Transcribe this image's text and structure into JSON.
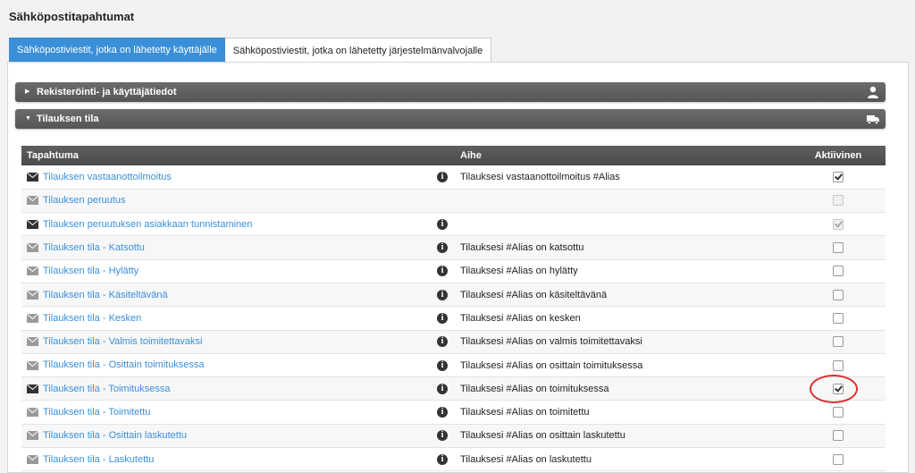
{
  "page": {
    "title": "Sähköpostitapahtumat"
  },
  "tabs": [
    {
      "label": "Sähköpostiviestit, jotka on lähetetty käyttäjälle",
      "active": true
    },
    {
      "label": "Sähköpostiviestit, jotka on lähetetty järjestelmänvalvojalle",
      "active": false
    }
  ],
  "sections": [
    {
      "label": "Rekisteröinti- ja käyttäjätiedot",
      "expanded": false,
      "icon": "user-icon"
    },
    {
      "label": "Tilauksen tila",
      "expanded": true,
      "icon": "truck-icon"
    }
  ],
  "table": {
    "headers": {
      "event": "Tapahtuma",
      "subject": "Aihe",
      "active": "Aktiivinen"
    },
    "rows": [
      {
        "event": "Tilauksen vastaanottoilmoitus",
        "subject": "Tilauksesi vastaanottoilmoitus #Alias",
        "info": true,
        "checked": true,
        "disabled": false,
        "envelope": "dark"
      },
      {
        "event": "Tilauksen peruutus",
        "subject": "",
        "info": false,
        "checked": false,
        "disabled": true,
        "envelope": "light"
      },
      {
        "event": "Tilauksen peruutuksen asiakkaan tunnistaminen",
        "subject": "",
        "info": true,
        "checked": true,
        "disabled": true,
        "envelope": "dark"
      },
      {
        "event": "Tilauksen tila - Katsottu",
        "subject": "Tilauksesi #Alias on katsottu",
        "info": true,
        "checked": false,
        "disabled": false,
        "envelope": "light"
      },
      {
        "event": "Tilauksen tila - Hylätty",
        "subject": "Tilauksesi #Alias on hylätty",
        "info": true,
        "checked": false,
        "disabled": false,
        "envelope": "light"
      },
      {
        "event": "Tilauksen tila - Käsiteltävänä",
        "subject": "Tilauksesi #Alias on käsiteltävänä",
        "info": true,
        "checked": false,
        "disabled": false,
        "envelope": "light"
      },
      {
        "event": "Tilauksen tila - Kesken",
        "subject": "Tilauksesi #Alias on kesken",
        "info": true,
        "checked": false,
        "disabled": false,
        "envelope": "light"
      },
      {
        "event": "Tilauksen tila - Valmis toimitettavaksi",
        "subject": "Tilauksesi #Alias on valmis toimitettavaksi",
        "info": true,
        "checked": false,
        "disabled": false,
        "envelope": "light"
      },
      {
        "event": "Tilauksen tila - Osittain toimituksessa",
        "subject": "Tilauksesi #Alias on osittain toimituksessa",
        "info": true,
        "checked": false,
        "disabled": false,
        "envelope": "light"
      },
      {
        "event": "Tilauksen tila - Toimituksessa",
        "subject": "Tilauksesi #Alias on toimituksessa",
        "info": true,
        "checked": true,
        "disabled": false,
        "envelope": "dark"
      },
      {
        "event": "Tilauksen tila - Toimitettu",
        "subject": "Tilauksesi #Alias on toimitettu",
        "info": true,
        "checked": false,
        "disabled": false,
        "envelope": "light"
      },
      {
        "event": "Tilauksen tila - Osittain laskutettu",
        "subject": "Tilauksesi #Alias on osittain laskutettu",
        "info": true,
        "checked": false,
        "disabled": false,
        "envelope": "light"
      },
      {
        "event": "Tilauksen tila - Laskutettu",
        "subject": "Tilauksesi #Alias on laskutettu",
        "info": true,
        "checked": false,
        "disabled": false,
        "envelope": "light"
      }
    ]
  },
  "colors": {
    "accent": "#3a8fd9",
    "highlight": "#e03030",
    "envelope_dark": "#333333",
    "envelope_light": "#9a9a9a"
  }
}
